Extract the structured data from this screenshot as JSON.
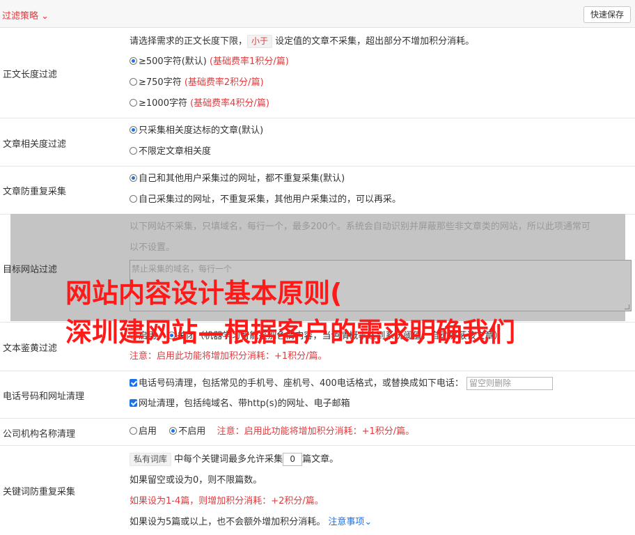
{
  "header": {
    "title": "过滤策略 ⌄",
    "save_label": "快速保存"
  },
  "length_filter": {
    "label": "正文长度过滤",
    "intro_a": "请选择需求的正文长度下限，",
    "intro_tag": "小于",
    "intro_b": " 设定值的文章不采集，超出部分不增加积分消耗。",
    "options": [
      {
        "text": "≥500字符(默认) ",
        "note": "(基础费率1积分/篇)"
      },
      {
        "text": "≥750字符 ",
        "note": "(基础费率2积分/篇)"
      },
      {
        "text": "≥1000字符 ",
        "note": "(基础费率4积分/篇)"
      }
    ]
  },
  "relevance": {
    "label": "文章相关度过滤",
    "opt1": "只采集相关度达标的文章(默认)",
    "opt2": "不限定文章相关度"
  },
  "dedupe": {
    "label": "文章防重复采集",
    "opt1": "自己和其他用户采集过的网址，都不重复采集(默认)",
    "opt2": "自己采集过的网址，不重复采集，其他用户采集过的，可以再采。"
  },
  "target_site": {
    "label": "目标网站过滤",
    "desc1": "以下网站不采集，只填域名，每行一个，最多200个。系统会自动识别并屏蔽那些非文章类的网站，所以此项通常可",
    "desc2": "以不设置。",
    "placeholder": "禁止采集的域名，每行一个"
  },
  "porn_filter": {
    "label": "文本鉴黄过滤",
    "opt_on": "启用",
    "opt_off": "关闭",
    "desc": "（机器学习智能鉴别色情内容，当色情概率达到系统阈值，自动屏蔽该文章）",
    "note": "注意：启用此功能将增加积分消耗：+1积分/篇。"
  },
  "phone_url": {
    "label": "电话号码和网址清理",
    "phone": "电话号码清理，包括常见的手机号、座机号、400电话格式，或替换成如下电话：",
    "phone_placeholder": "留空则删除",
    "url": "网址清理，包括纯域名、带http(s)的网址、电子邮箱"
  },
  "company": {
    "label": "公司机构名称清理",
    "opt_on": "启用",
    "opt_off": "不启用",
    "note": "注意：启用此功能将增加积分消耗：+1积分/篇。"
  },
  "keyword_dedupe": {
    "label": "关键词防重复采集",
    "tag": "私有词库",
    "line1_a": " 中每个关键词最多允许采集",
    "value": "0",
    "line1_b": "篇文章。",
    "line2": "如果留空或设为0，则不限篇数。",
    "line3": "如果设为1-4篇，则增加积分消耗：+2积分/篇。",
    "line4": "如果设为5篇或以上，也不会额外增加积分消耗。",
    "notes_link": "注意事项⌄"
  },
  "watermark": {
    "line1": "网站内容设计基本原则(",
    "line2": "深圳建网站—根据客户的需求明确我们"
  }
}
